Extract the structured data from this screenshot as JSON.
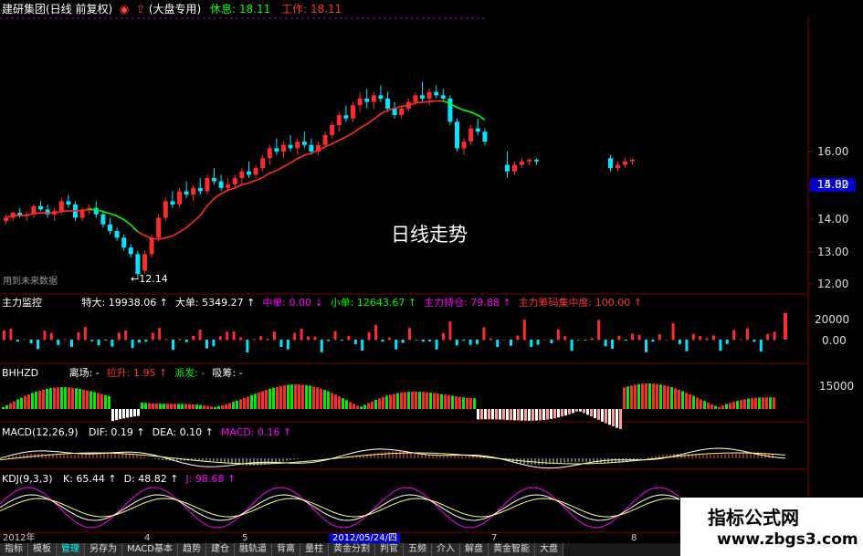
{
  "header": {
    "stock_name": "建研集团(日线 前复权)",
    "indicator_label": "(大盘专用)",
    "rest": "休息: 18.11",
    "work": "工作: 18.11"
  },
  "main_overlay": {
    "label": "日线走势",
    "future_data_label": "用到未来数据",
    "low_marker": "12.14",
    "current_price": "14.82"
  },
  "price_axis": [
    "16.00",
    "15.00",
    "14.00",
    "13.00",
    "12.00"
  ],
  "pane_zlkz": {
    "title": "主力监控",
    "items": [
      {
        "label": "特大: 19938.06",
        "arrow": "↑",
        "color": "#ffffff"
      },
      {
        "label": "大单: 5349.27",
        "arrow": "↑",
        "color": "#ffffff"
      },
      {
        "label": "中单: 0.00",
        "arrow": "↓",
        "color": "#ff00ff"
      },
      {
        "label": "小单: 12643.67",
        "arrow": "↑",
        "color": "#00ff00"
      },
      {
        "label": "主力持仓: 79.88",
        "arrow": "↑",
        "color": "#ff00ff"
      },
      {
        "label": "主力筹码集中度: 100.00",
        "arrow": "↑",
        "color": "#ff3333"
      }
    ],
    "axis": [
      "20000",
      "0.00"
    ]
  },
  "pane_bhhzd": {
    "title": "BHHZD",
    "items": [
      {
        "label": "离场: -",
        "color": "#ffffff"
      },
      {
        "label": "拉升: 1.95",
        "arrow": "↑",
        "color": "#ff3333"
      },
      {
        "label": "派发: -",
        "color": "#00ff00"
      },
      {
        "label": "吸筹: -",
        "color": "#ffffff"
      }
    ],
    "axis": [
      "15000"
    ]
  },
  "pane_macd": {
    "title": "MACD(12,26,9)",
    "items": [
      {
        "label": "DIF: 0.19",
        "arrow": "↑",
        "color": "#ffffff"
      },
      {
        "label": "DEA: 0.10",
        "arrow": "↑",
        "color": "#ffffff"
      },
      {
        "label": "MACD: 0.16",
        "arrow": "↑",
        "color": "#ff00ff"
      }
    ]
  },
  "pane_kdj": {
    "title": "KDJ(9,3,3)",
    "items": [
      {
        "label": "K: 65.44",
        "arrow": "↑",
        "color": "#ffffff"
      },
      {
        "label": "D: 48.82",
        "arrow": "↑",
        "color": "#ffffff"
      },
      {
        "label": "J: 98.68",
        "arrow": "↑",
        "color": "#ff00ff"
      }
    ]
  },
  "date_bar": [
    "2012年",
    "4",
    "5",
    "2012/05/24/四",
    "7",
    "8"
  ],
  "bottom_tabs": [
    {
      "label": "指标",
      "active": false
    },
    {
      "label": "模板",
      "active": false
    },
    {
      "label": "管理",
      "active": true
    },
    {
      "label": "另存为",
      "active": false
    },
    {
      "label": "MACD基本",
      "active": false
    },
    {
      "label": "趋势",
      "active": false
    },
    {
      "label": "建仓",
      "active": false
    },
    {
      "label": "融轨道",
      "active": false
    },
    {
      "label": "背离",
      "active": false
    },
    {
      "label": "量柱",
      "active": false
    },
    {
      "label": "黄金分割",
      "active": false
    },
    {
      "label": "判官",
      "active": false
    },
    {
      "label": "五频",
      "active": false
    },
    {
      "label": "介入",
      "active": false
    },
    {
      "label": "解盘",
      "active": false
    },
    {
      "label": "黄金智能",
      "active": false
    },
    {
      "label": "大盘",
      "active": false
    }
  ],
  "watermark": {
    "line1": "指标公式网",
    "line2": "www.zbgs3.com"
  },
  "colors": {
    "up": "#ff2a2a",
    "down": "#00e5ff",
    "ma": "#ff2a2a",
    "ma_green": "#00ff00",
    "grid": "#7a0000"
  },
  "chart_data": {
    "type": "candlestick",
    "ohlc": [
      [
        13.9,
        14.1,
        13.8,
        14.0
      ],
      [
        14.0,
        14.2,
        13.9,
        14.15
      ],
      [
        14.15,
        14.3,
        14.0,
        14.05
      ],
      [
        14.05,
        14.2,
        13.9,
        14.1
      ],
      [
        14.1,
        14.4,
        14.0,
        14.35
      ],
      [
        14.35,
        14.5,
        14.2,
        14.25
      ],
      [
        14.25,
        14.4,
        14.0,
        14.1
      ],
      [
        14.1,
        14.3,
        13.9,
        14.2
      ],
      [
        14.2,
        14.6,
        14.1,
        14.5
      ],
      [
        14.5,
        14.7,
        14.3,
        14.4
      ],
      [
        14.4,
        14.5,
        13.9,
        14.0
      ],
      [
        14.0,
        14.3,
        13.9,
        14.25
      ],
      [
        14.25,
        14.4,
        14.1,
        14.3
      ],
      [
        14.3,
        14.5,
        14.0,
        14.1
      ],
      [
        14.1,
        14.2,
        13.7,
        13.8
      ],
      [
        13.8,
        14.0,
        13.5,
        13.6
      ],
      [
        13.6,
        13.7,
        13.3,
        13.4
      ],
      [
        13.4,
        13.5,
        13.0,
        13.1
      ],
      [
        13.1,
        13.2,
        12.8,
        12.9
      ],
      [
        12.9,
        13.0,
        12.14,
        12.3
      ],
      [
        12.4,
        13.0,
        12.3,
        12.9
      ],
      [
        12.9,
        13.5,
        12.8,
        13.4
      ],
      [
        13.4,
        14.1,
        13.3,
        14.0
      ],
      [
        14.0,
        14.6,
        13.9,
        14.5
      ],
      [
        14.5,
        14.8,
        14.3,
        14.4
      ],
      [
        14.4,
        14.9,
        14.3,
        14.8
      ],
      [
        14.8,
        15.1,
        14.6,
        14.7
      ],
      [
        14.7,
        15.0,
        14.5,
        14.9
      ],
      [
        14.9,
        15.2,
        14.7,
        14.8
      ],
      [
        14.8,
        15.3,
        14.7,
        15.2
      ],
      [
        15.2,
        15.5,
        15.0,
        15.1
      ],
      [
        15.1,
        15.3,
        14.8,
        14.9
      ],
      [
        14.9,
        15.2,
        14.8,
        15.0
      ],
      [
        15.0,
        15.3,
        14.9,
        15.2
      ],
      [
        15.2,
        15.5,
        15.0,
        15.4
      ],
      [
        15.4,
        15.7,
        15.2,
        15.3
      ],
      [
        15.3,
        15.6,
        15.2,
        15.5
      ],
      [
        15.5,
        15.9,
        15.4,
        15.8
      ],
      [
        15.8,
        16.2,
        15.6,
        16.1
      ],
      [
        16.1,
        16.4,
        15.9,
        16.0
      ],
      [
        16.0,
        16.3,
        15.8,
        16.2
      ],
      [
        16.2,
        16.5,
        16.0,
        16.1
      ],
      [
        16.1,
        16.4,
        15.9,
        16.3
      ],
      [
        16.3,
        16.6,
        16.1,
        16.2
      ],
      [
        16.2,
        16.4,
        15.9,
        16.0
      ],
      [
        16.0,
        16.3,
        15.9,
        16.2
      ],
      [
        16.2,
        16.6,
        16.1,
        16.5
      ],
      [
        16.5,
        16.9,
        16.4,
        16.8
      ],
      [
        16.8,
        17.2,
        16.6,
        17.1
      ],
      [
        17.1,
        17.4,
        16.9,
        17.0
      ],
      [
        17.0,
        17.5,
        16.9,
        17.4
      ],
      [
        17.4,
        17.8,
        17.2,
        17.6
      ],
      [
        17.6,
        17.9,
        17.3,
        17.5
      ],
      [
        17.5,
        17.8,
        17.3,
        17.7
      ],
      [
        17.7,
        18.0,
        17.5,
        17.6
      ],
      [
        17.6,
        17.8,
        17.2,
        17.3
      ],
      [
        17.3,
        17.5,
        17.0,
        17.1
      ],
      [
        17.1,
        17.4,
        17.0,
        17.3
      ],
      [
        17.3,
        17.6,
        17.2,
        17.5
      ],
      [
        17.5,
        17.8,
        17.4,
        17.7
      ],
      [
        17.7,
        18.11,
        17.5,
        17.6
      ],
      [
        17.6,
        17.9,
        17.4,
        17.8
      ],
      [
        17.8,
        18.0,
        17.6,
        17.7
      ],
      [
        17.7,
        17.9,
        17.5,
        17.6
      ],
      [
        17.6,
        17.7,
        16.8,
        16.9
      ],
      [
        16.9,
        17.0,
        16.0,
        16.1
      ],
      [
        16.1,
        16.4,
        15.9,
        16.3
      ],
      [
        16.3,
        16.8,
        16.2,
        16.7
      ],
      [
        16.7,
        17.0,
        16.5,
        16.6
      ],
      [
        16.6,
        16.7,
        16.2,
        16.3
      ]
    ],
    "gap_ohlc": [
      [
        15.6,
        16.0,
        15.2,
        15.4
      ],
      [
        15.4,
        15.7,
        15.3,
        15.6
      ],
      [
        15.6,
        15.8,
        15.5,
        15.7
      ],
      [
        15.7,
        15.8,
        15.6,
        15.75
      ],
      [
        15.75,
        15.8,
        15.6,
        15.7
      ]
    ],
    "late_ohlc": [
      [
        15.8,
        15.9,
        15.4,
        15.5
      ],
      [
        15.5,
        15.7,
        15.4,
        15.6
      ],
      [
        15.6,
        15.8,
        15.5,
        15.7
      ],
      [
        15.7,
        15.8,
        15.6,
        15.75
      ]
    ],
    "ylim": [
      11.8,
      18.3
    ]
  }
}
